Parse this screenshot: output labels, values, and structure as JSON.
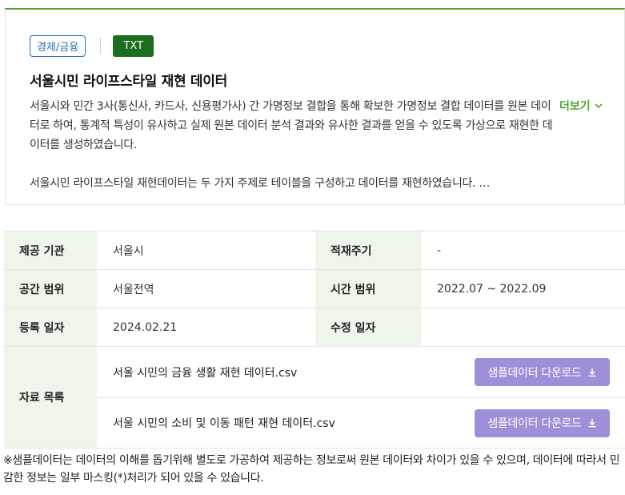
{
  "dataset": {
    "category": "경제/금융",
    "format": "TXT",
    "title": "서울시민 라이프스타일 재현 데이터",
    "description_p1": "서울시와 민간 3사(통신사, 카드사, 신용평가사) 간 가명정보 결합을 통해 확보한 가명정보 결합 데이터를 원본 데이터로 하여, 통계적 특성이 유사하고 실제 원본 데이터 분석 결과와 유사한 결과를 얻을 수 있도록 가상으로 재현한 데이터를 생성하였습니다.",
    "description_p2": "서울시민 라이프스타일 재현데이터는 두 가지 주제로 테이블을 구성하고 데이터를 재현하였습니다. …",
    "more_label": "더보기"
  },
  "meta": {
    "provider_label": "제공 기관",
    "provider_value": "서울시",
    "cycle_label": "적재주기",
    "cycle_value": "-",
    "space_label": "공간 범위",
    "space_value": "서울전역",
    "time_label": "시간 범위",
    "time_value": "2022.07 ~ 2022.09",
    "reg_label": "등록 일자",
    "reg_value": "2024.02.21",
    "mod_label": "수정 일자",
    "mod_value": "",
    "files_label": "자료 목록",
    "files": [
      {
        "name": "서울 시민의 금융 생활 재현 데이터.csv",
        "button": "샘플데이터 다운로드"
      },
      {
        "name": "서울 시민의 소비 및 이동 패턴 재현 데이터.csv",
        "button": "샘플데이터 다운로드"
      }
    ]
  },
  "note": "※샘플데이터는 데이터의 이해를 돕기위해 별도로 가공하여 제공하는 정보로써 원본 데이터와 차이가 있을 수 있으며, 데이터에 따라서 민감한 정보는 일부 마스킹(*)처리가 되어 있을 수 있습니다.",
  "colors": {
    "accent_green": "#52a52e",
    "format_badge": "#1b6d20",
    "category_blue": "#2f6fb5",
    "table_header_bg": "#eef5ea",
    "download_button": "#9f8ed8"
  },
  "icons": [
    "chevron-down-icon",
    "download-icon"
  ]
}
